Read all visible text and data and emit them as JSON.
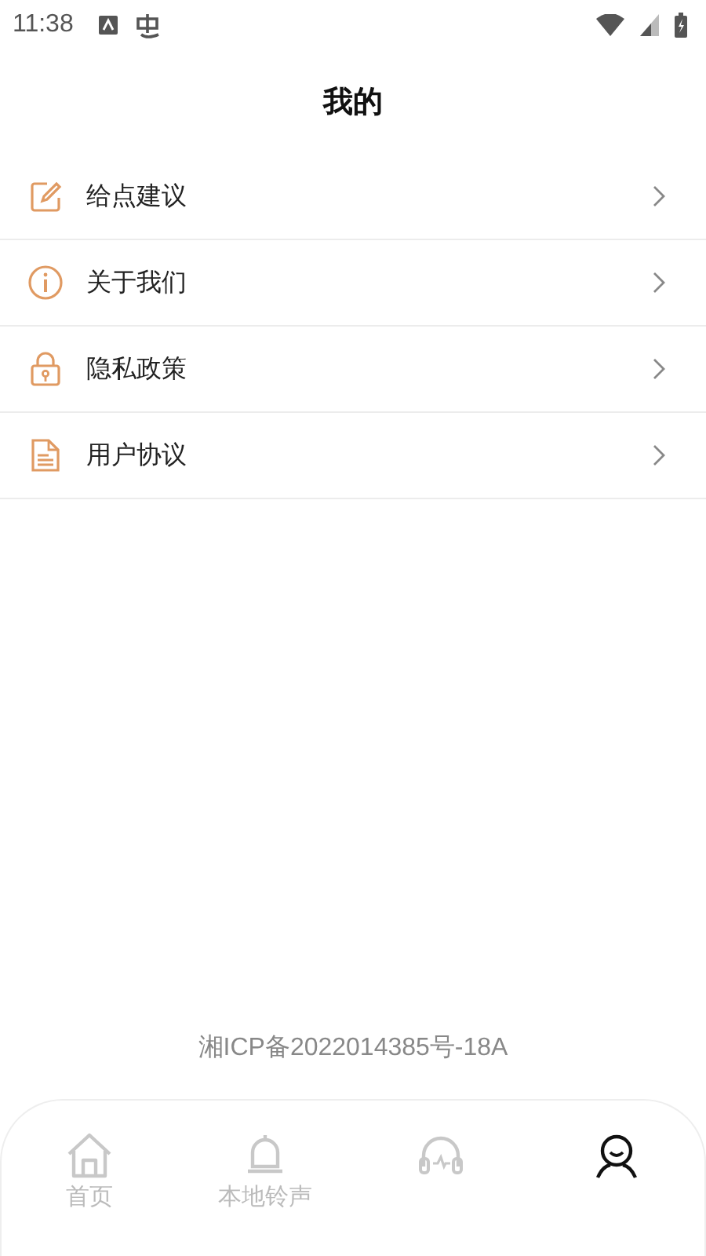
{
  "status_bar": {
    "time": "11:38"
  },
  "header": {
    "title": "我的"
  },
  "menu": [
    {
      "kind": "edit",
      "label": "给点建议"
    },
    {
      "kind": "info",
      "label": "关于我们"
    },
    {
      "kind": "lock",
      "label": "隐私政策"
    },
    {
      "kind": "document",
      "label": "用户协议"
    }
  ],
  "footer": {
    "license": "湘ICP备2022014385号-18A"
  },
  "tabs": [
    {
      "kind": "home",
      "label": "首页",
      "selected": false
    },
    {
      "kind": "bell",
      "label": "本地铃声",
      "selected": false
    },
    {
      "kind": "headphones",
      "selected": false
    },
    {
      "kind": "person",
      "selected": true
    }
  ]
}
